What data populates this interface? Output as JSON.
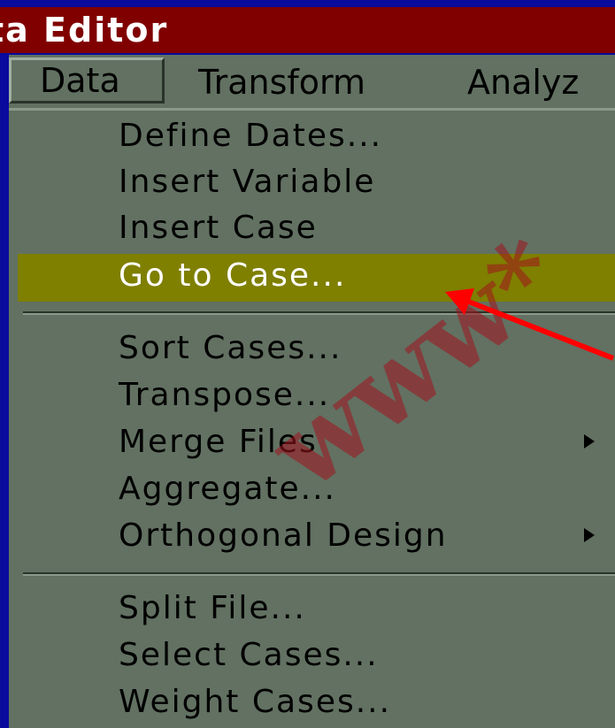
{
  "window": {
    "title": "ta Editor"
  },
  "menubar": {
    "data": "Data",
    "transform": "Transform",
    "analyze": "Analyz"
  },
  "menu": {
    "define_dates": "Define Dates...",
    "insert_variable": "Insert Variable",
    "insert_case": "Insert Case",
    "go_to_case": "Go to Case...",
    "sort_cases": "Sort Cases...",
    "transpose": "Transpose...",
    "merge_files": "Merge Files",
    "aggregate": "Aggregate...",
    "orthogonal_design": "Orthogonal Design",
    "split_file": "Split File...",
    "select_cases": "Select Cases...",
    "weight_cases": "Weight Cases..."
  },
  "selected_item": "go_to_case",
  "watermark": {
    "text": "www*",
    "color": "#a0141e"
  },
  "colors": {
    "title_bar": "#800000",
    "menu_bg": "#627162",
    "highlight": "#7f7f00",
    "frame": "#0a0a9c",
    "annotation_arrow": "#ff0000"
  }
}
